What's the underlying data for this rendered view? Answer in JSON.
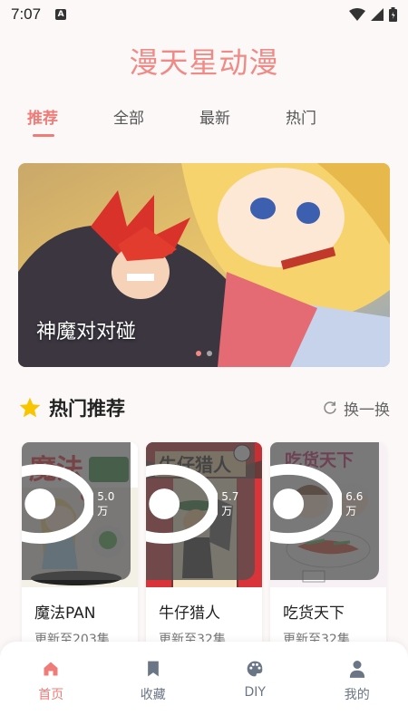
{
  "status": {
    "time": "7:07",
    "notif_glyph": "A"
  },
  "app": {
    "title": "漫天星动漫"
  },
  "tabs": [
    {
      "label": "推荐",
      "active": true
    },
    {
      "label": "全部",
      "active": false
    },
    {
      "label": "最新",
      "active": false
    },
    {
      "label": "热门",
      "active": false
    }
  ],
  "banner": {
    "caption": "神魔对对碰",
    "dot_count": 2,
    "active_dot": 0
  },
  "section": {
    "title": "热门推荐",
    "icon": "star-icon",
    "refresh_label": "换一换",
    "refresh_icon": "refresh-icon"
  },
  "comics": [
    {
      "title": "魔法PAN",
      "subtitle": "更新至203集",
      "views": "5.0万"
    },
    {
      "title": "牛仔猎人",
      "subtitle": "更新至32集",
      "views": "5.7万"
    },
    {
      "title": "吃货天下",
      "subtitle": "更新至32集",
      "views": "6.6万"
    }
  ],
  "nav": [
    {
      "label": "首页",
      "icon": "home-icon",
      "active": true
    },
    {
      "label": "收藏",
      "icon": "bookmark-icon",
      "active": false
    },
    {
      "label": "DIY",
      "icon": "palette-icon",
      "active": false
    },
    {
      "label": "我的",
      "icon": "user-icon",
      "active": false
    }
  ],
  "colors": {
    "accent": "#ef7c79",
    "title": "#f08a86",
    "star": "#f7c600",
    "nav_inactive": "#6a7585"
  }
}
